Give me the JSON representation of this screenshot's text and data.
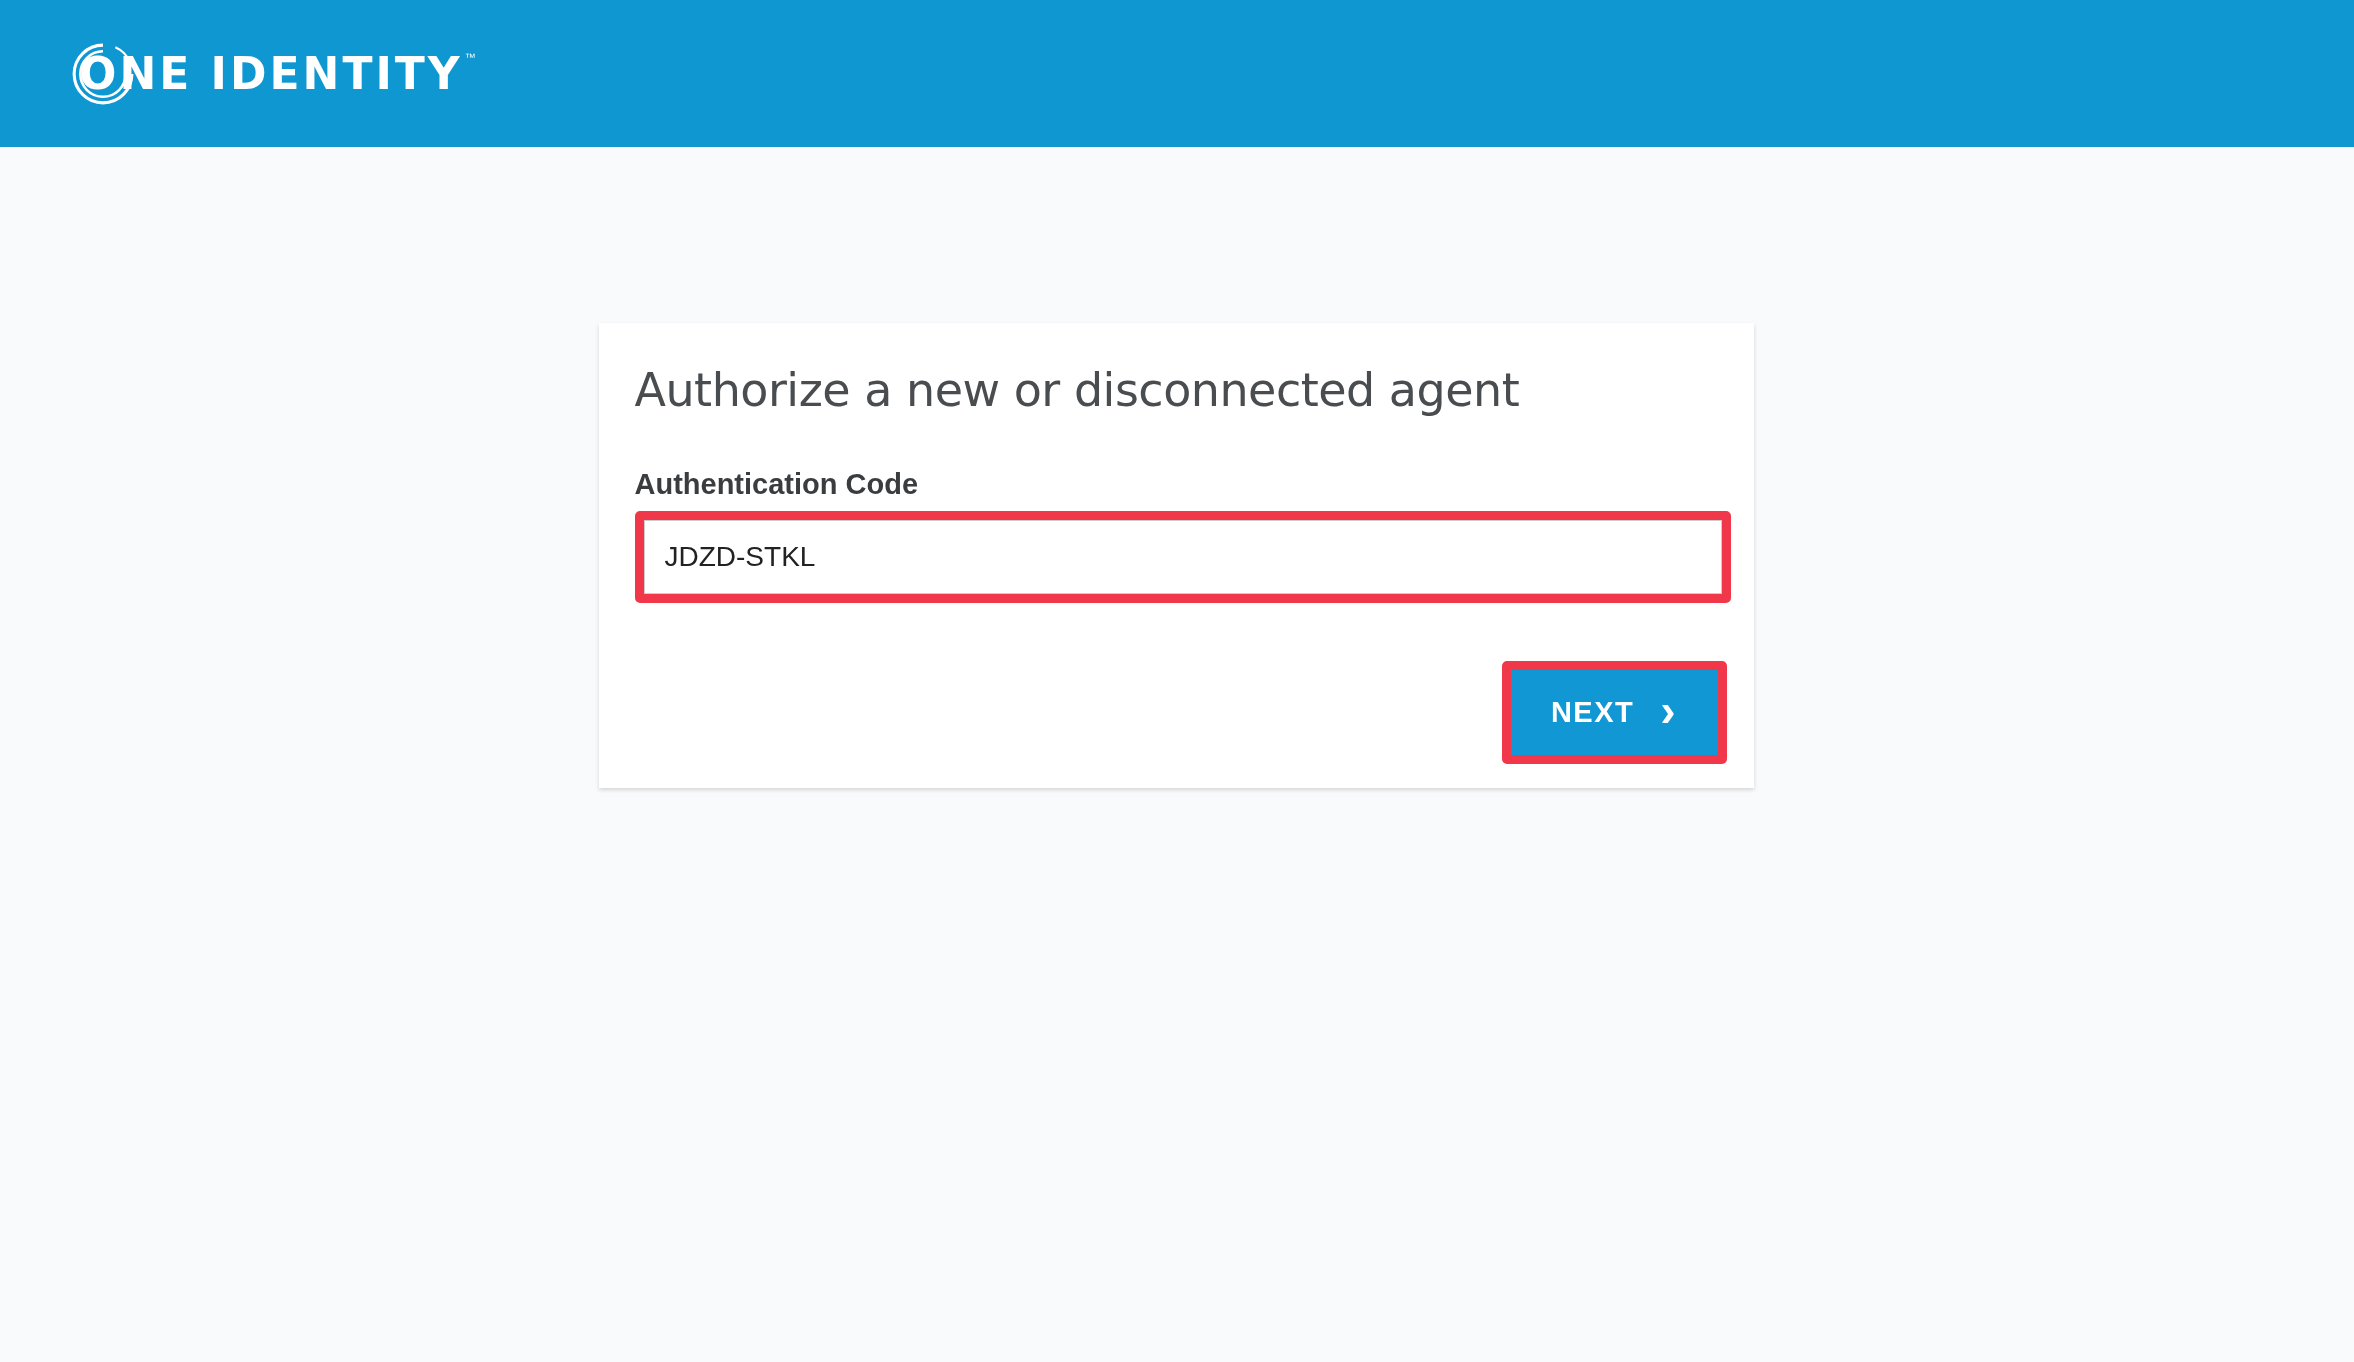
{
  "header": {
    "logo": {
      "text": "ONE IDENTITY",
      "trademark": "™"
    }
  },
  "card": {
    "title": "Authorize a new or disconnected agent",
    "field": {
      "label": "Authentication Code",
      "value": "JDZD-STKL",
      "highlighted": true
    },
    "button": {
      "label": "NEXT",
      "icon": "›",
      "highlighted": true
    }
  }
}
